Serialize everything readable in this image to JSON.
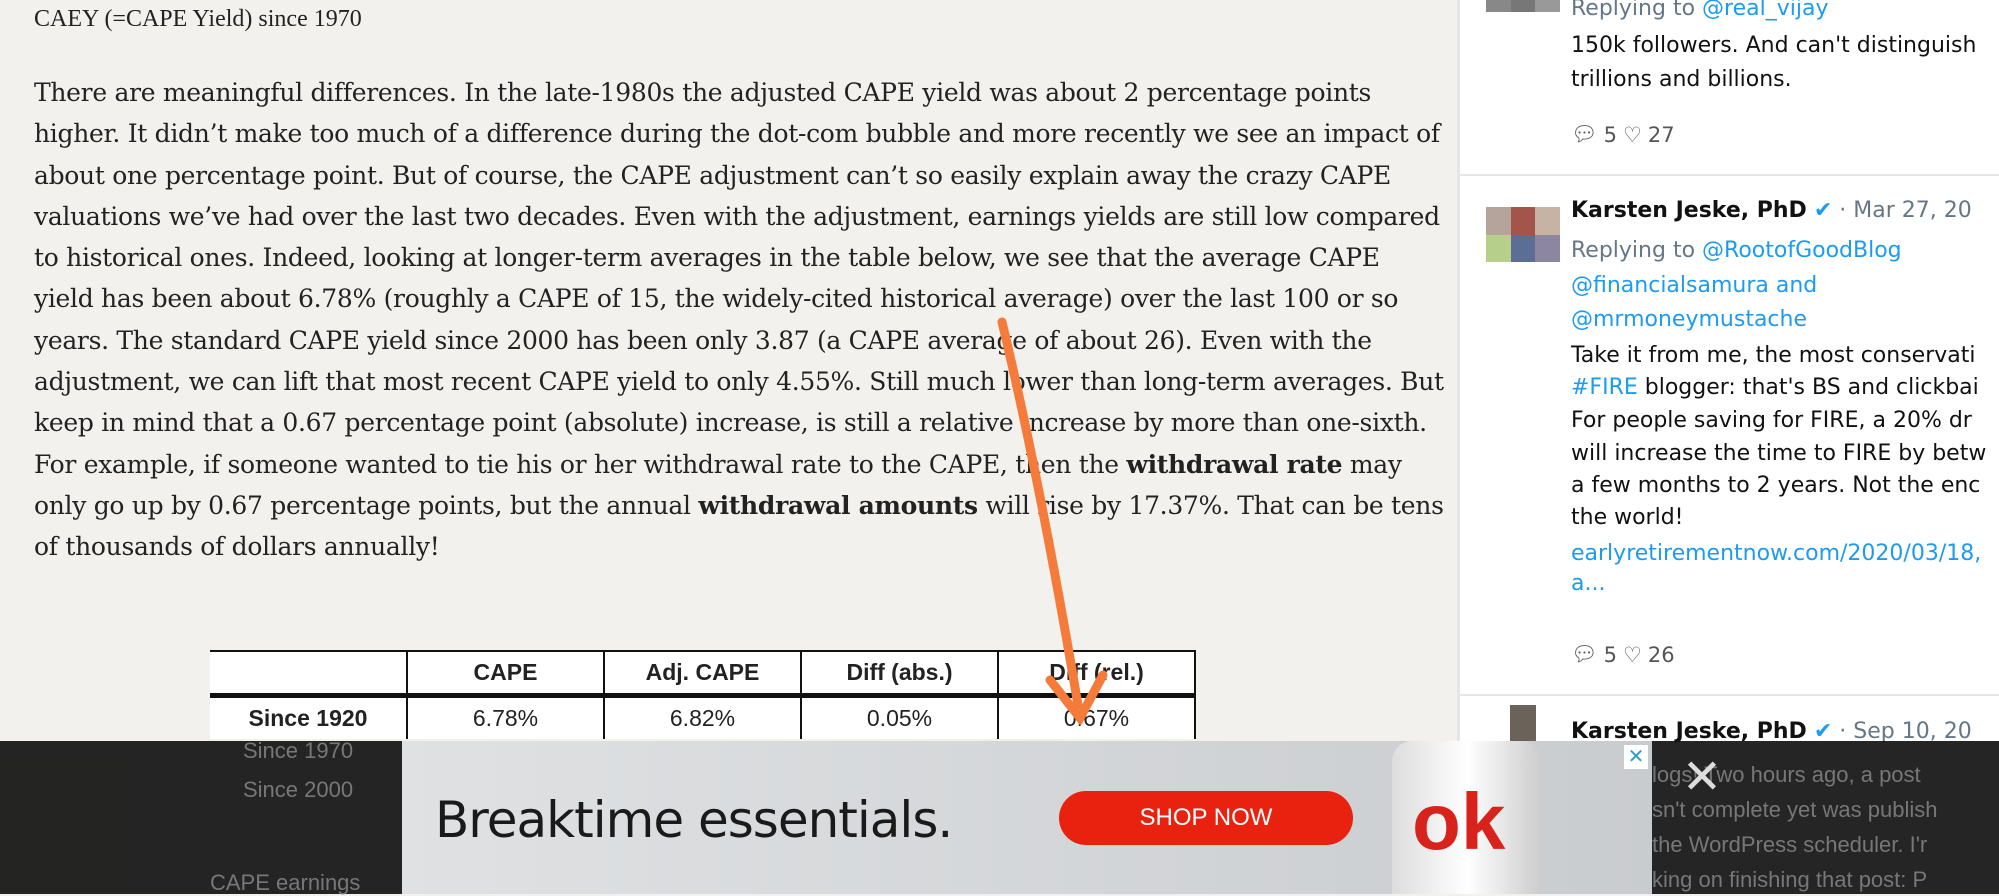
{
  "article": {
    "title": "CAEY (=CAPE Yield) since 1970",
    "p1": "There are meaningful differences. In the late-1980s the adjusted CAPE yield was about 2 percentage points higher. It didn’t make too much of a difference during the dot-com bubble and more recently we see an impact of about one percentage point. But of course, the CAPE adjustment can’t so easily explain away the crazy CAPE valuations we’ve had over the last two decades. Even with the adjustment, earnings yields are still low compared to historical ones. Indeed, looking at longer-term averages in the table below, we see that the average CAPE yield has been about 6.78% (roughly a CAPE of 15, the widely-cited historical average) over the last 100 or so years. The standard CAPE yield since 2000 has been only 3.87 (a CAPE average of about 26). Even with the adjustment, we can lift that most recent CAPE yield to only 4.55%. Still much lower than long-term averages. But keep in mind that a 0.67 percentage point (absolute) increase, is still a relative increase by more than one-sixth. For example, if someone wanted to tie his or her withdrawal rate to the CAPE, then the ",
    "b1": "withdrawal rate",
    "p2": " may only go up by 0.67 percentage points, but the annual ",
    "b2": "withdrawal amounts",
    "p3": " will rise by 17.37%. That can be tens of thousands of dollars annually!",
    "table": {
      "headers": [
        "",
        "CAPE",
        "Adj. CAPE",
        "Diff (abs.)",
        "Diff (rel.)"
      ],
      "row1": [
        "Since 1920",
        "6.78%",
        "6.82%",
        "0.05%",
        "0.67%"
      ],
      "row_labels_obscured": [
        "Since 1970",
        "Since 2000"
      ]
    },
    "next_heading": "CAPE earnings"
  },
  "tweets": [
    {
      "replying_label": "Replying to",
      "replying_to": "@real_vijay",
      "text1": "150k followers. And can't distinguish",
      "text2": "trillions and billions.",
      "replies": "5",
      "likes": "27"
    },
    {
      "name": "Karsten Jeske, PhD",
      "date": "· Mar 27, 20",
      "replying_label": "Replying to",
      "r1": "@RootofGoodBlog",
      "r2": "@financialsamura and",
      "r3": "@mrmoneymustache",
      "l1": "Take it from me, the most conservati",
      "hashtag": "#FIRE",
      "l2": " blogger: that's BS and clickbai",
      "l3": "For people saving for FIRE, a 20% dr",
      "l4": "will increase the time to FIRE by betw",
      "l5": "a few months to 2 years. Not the enc",
      "l6": "the world!",
      "link1": "earlyretirementnow.com/2020/03/18,",
      "link2": "a...",
      "replies": "5",
      "likes": "26"
    },
    {
      "name": "Karsten Jeske, PhD",
      "date": "· Sep 10, 20",
      "l1": "logs! Two hours ago, a post",
      "l2": "sn't complete yet was publish",
      "l3": "the WordPress scheduler. I'r",
      "l4": "king on finishing that post: P"
    }
  ],
  "ad": {
    "headline": "Breaktime essentials.",
    "cta": "SHOP NOW",
    "brand": "Coke",
    "close": "✕",
    "overlay_close": "✕"
  },
  "colors": {
    "link": "#1d9bf0",
    "cta": "#e8220f",
    "arrow": "#f47b3a"
  }
}
